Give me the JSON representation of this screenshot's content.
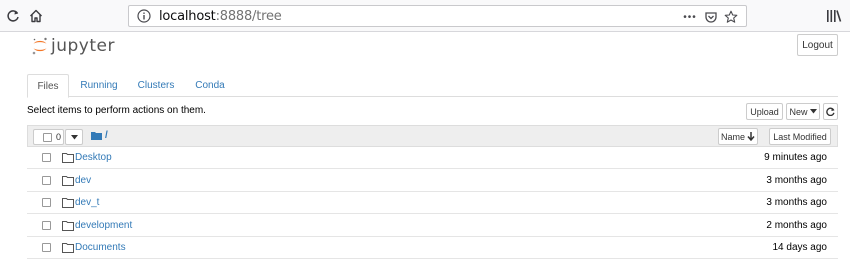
{
  "browser": {
    "url_host": "localhost",
    "url_rest": ":8888/tree",
    "more_glyph": "•••"
  },
  "header": {
    "logo_text": "jupyter",
    "logout_label": "Logout"
  },
  "tabs": [
    {
      "label": "Files",
      "active": true
    },
    {
      "label": "Running",
      "active": false
    },
    {
      "label": "Clusters",
      "active": false
    },
    {
      "label": "Conda",
      "active": false
    }
  ],
  "toolbar": {
    "hint": "Select items to perform actions on them.",
    "upload_label": "Upload",
    "new_label": "New",
    "selected_count": "0",
    "breadcrumb_path": "/",
    "sort_name_label": "Name",
    "sort_modified_label": "Last Modified"
  },
  "files": [
    {
      "name": "Desktop",
      "modified": "9 minutes ago"
    },
    {
      "name": "dev",
      "modified": "3 months ago"
    },
    {
      "name": "dev_t",
      "modified": "3 months ago"
    },
    {
      "name": "development",
      "modified": "2 months ago"
    },
    {
      "name": "Documents",
      "modified": "14 days ago"
    }
  ],
  "colors": {
    "link": "#337ab7",
    "logo_orange": "#f37626"
  }
}
